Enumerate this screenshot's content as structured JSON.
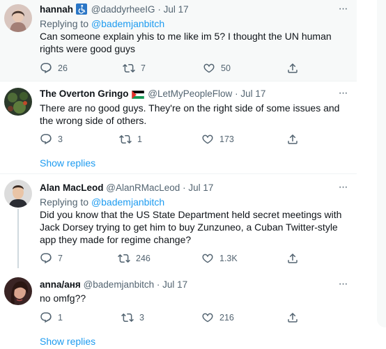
{
  "tweets": [
    {
      "name": "hannah",
      "handle": "@daddyrheeIG",
      "sep": "·",
      "date": "Jul 17",
      "replying_label": "Replying to",
      "replying_to": "@bademjanbitch",
      "text": "Can someone explain yhis to me like im 5? I thought the UN human rights were good guys",
      "replies": "26",
      "retweets": "7",
      "likes": "50",
      "badge_icon": "accessibility-icon"
    },
    {
      "name": "The Overton Gringo",
      "handle": "@LetMyPeopleFlow",
      "sep": "·",
      "date": "Jul 17",
      "text": "There are no good guys. They're on the right side of some issues and the wrong side of others.",
      "replies": "3",
      "retweets": "1",
      "likes": "173",
      "badge_icon": "palestine-flag-icon",
      "show_replies": "Show replies"
    },
    {
      "name": "Alan MacLeod",
      "handle": "@AlanRMacLeod",
      "sep": "·",
      "date": "Jul 17",
      "replying_label": "Replying to",
      "replying_to": "@bademjanbitch",
      "text": "Did you know that the US State Department held secret meetings with Jack Dorsey trying to get him to buy Zunzuneo, a Cuban Twitter-style app they made for regime change?",
      "replies": "7",
      "retweets": "246",
      "likes": "1.3K"
    },
    {
      "name": "anna/аня",
      "handle": "@bademjanbitch",
      "sep": "·",
      "date": "Jul 17",
      "text": "no omfg??",
      "replies": "1",
      "retweets": "3",
      "likes": "216",
      "show_replies": "Show replies"
    }
  ],
  "colors": {
    "link": "#1d9bf0",
    "secondary_text": "#536471",
    "highlight_bg": "#f7f9f9",
    "divider": "#eff3f4"
  },
  "icons": [
    "reply-icon",
    "retweet-icon",
    "like-icon",
    "share-icon",
    "more-icon"
  ]
}
